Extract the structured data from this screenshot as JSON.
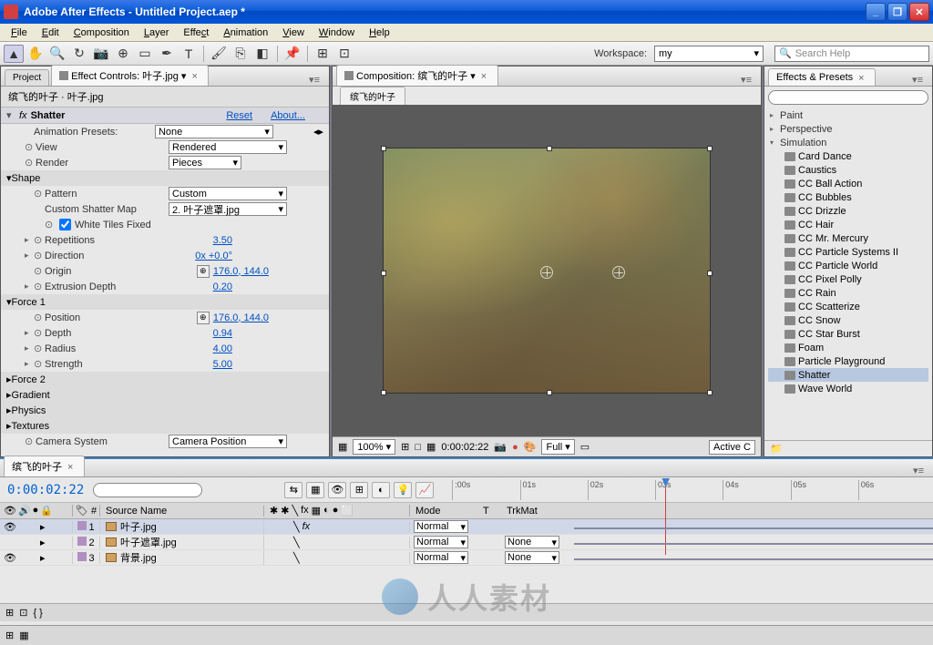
{
  "titlebar": {
    "title": "Adobe After Effects - Untitled Project.aep *"
  },
  "menubar": {
    "items": [
      "File",
      "Edit",
      "Composition",
      "Layer",
      "Effect",
      "Animation",
      "View",
      "Window",
      "Help"
    ]
  },
  "toolbar": {
    "workspace_label": "Workspace:",
    "workspace_value": "my",
    "search_placeholder": "Search Help"
  },
  "left_panel": {
    "tab_project": "Project",
    "tab_effect_controls": "Effect Controls: 叶子.jpg",
    "breadcrumb": "缤飞的叶子 · 叶子.jpg",
    "fx_name": "Shatter",
    "fx_reset": "Reset",
    "fx_about": "About...",
    "preset_label": "Animation Presets:",
    "preset_value": "None",
    "props": {
      "view": {
        "label": "View",
        "value": "Rendered"
      },
      "render": {
        "label": "Render",
        "value": "Pieces"
      },
      "shape": "Shape",
      "pattern": {
        "label": "Pattern",
        "value": "Custom"
      },
      "shatter_map": {
        "label": "Custom Shatter Map",
        "value": "2. 叶子遮罩.jpg"
      },
      "white_tiles": "White Tiles Fixed",
      "repetitions": {
        "label": "Repetitions",
        "value": "3.50"
      },
      "direction": {
        "label": "Direction",
        "value": "0x +0.0°"
      },
      "origin": {
        "label": "Origin",
        "value": "176.0, 144.0"
      },
      "extrusion": {
        "label": "Extrusion Depth",
        "value": "0.20"
      },
      "force1": "Force 1",
      "position": {
        "label": "Position",
        "value": "176.0, 144.0"
      },
      "depth": {
        "label": "Depth",
        "value": "0.94"
      },
      "radius": {
        "label": "Radius",
        "value": "4.00"
      },
      "strength": {
        "label": "Strength",
        "value": "5.00"
      },
      "force2": "Force 2",
      "gradient": "Gradient",
      "physics": "Physics",
      "textures": "Textures",
      "camera_system": {
        "label": "Camera System",
        "value": "Camera Position"
      }
    }
  },
  "center_panel": {
    "tab_label": "Composition: 缤飞的叶子",
    "subtab": "缤飞的叶子",
    "footer": {
      "zoom": "100%",
      "time": "0:00:02:22",
      "resolution": "Full",
      "active": "Active C"
    }
  },
  "right_panel": {
    "tab_label": "Effects & Presets",
    "categories": {
      "paint": "Paint",
      "perspective": "Perspective",
      "simulation": "Simulation"
    },
    "effects": [
      "Card Dance",
      "Caustics",
      "CC Ball Action",
      "CC Bubbles",
      "CC Drizzle",
      "CC Hair",
      "CC Mr. Mercury",
      "CC Particle Systems II",
      "CC Particle World",
      "CC Pixel Polly",
      "CC Rain",
      "CC Scatterize",
      "CC Snow",
      "CC Star Burst",
      "Foam",
      "Particle Playground",
      "Shatter",
      "Wave World"
    ]
  },
  "timeline": {
    "tab_label": "缤飞的叶子",
    "timecode": "0:00:02:22",
    "col_source": "Source Name",
    "col_mode": "Mode",
    "col_trkmat": "TrkMat",
    "col_t": "T",
    "ruler_marks": [
      ":00s",
      "01s",
      "02s",
      "03s",
      "04s",
      "05s",
      "06s"
    ],
    "layers": [
      {
        "num": "1",
        "name": "叶子.jpg",
        "mode": "Normal",
        "trkmat": "",
        "selected": true,
        "visible": true,
        "fx": "fx"
      },
      {
        "num": "2",
        "name": "叶子遮罩.jpg",
        "mode": "Normal",
        "trkmat": "None",
        "selected": false,
        "visible": false,
        "fx": ""
      },
      {
        "num": "3",
        "name": "背景.jpg",
        "mode": "Normal",
        "trkmat": "None",
        "selected": false,
        "visible": true,
        "fx": ""
      }
    ]
  },
  "watermark": {
    "text": "人人素材"
  }
}
